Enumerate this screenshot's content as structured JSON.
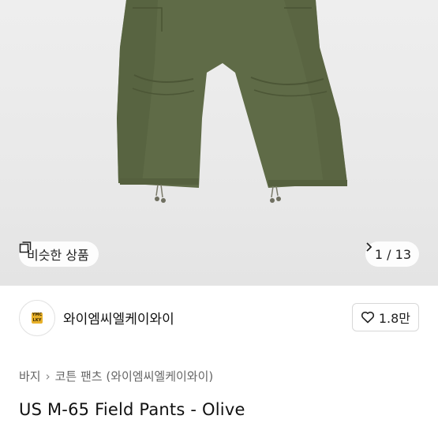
{
  "gallery": {
    "similar_label": "비슷한 상품",
    "counter": "1 / 13",
    "image_alt": "product-photo-olive-field-pants"
  },
  "shop": {
    "name": "와이엠씨엘케이와이",
    "likes": "1.8만",
    "logo_text": "YMC LKY"
  },
  "breadcrumb": {
    "items": [
      "바지",
      "코튼 팬츠 (와이엠씨엘케이와이)"
    ]
  },
  "product": {
    "title": "US M-65 Field Pants - Olive"
  },
  "colors": {
    "pants": "#5f6b47",
    "hero_bg": "#ececec",
    "logo": "#e8b12a"
  }
}
